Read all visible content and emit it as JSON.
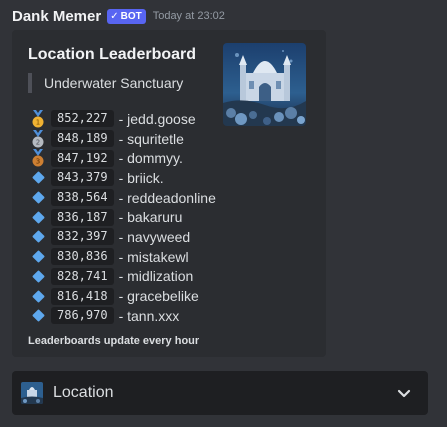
{
  "message": {
    "author": "Dank Memer",
    "bot_badge": "BOT",
    "timestamp": "Today at 23:02"
  },
  "embed": {
    "title": "Location Leaderboard",
    "subtitle": "Underwater Sanctuary",
    "thumbnail_icon": "underwater-sanctuary-image",
    "footer": "Leaderboards update every hour",
    "rows": [
      {
        "icon": "gold-medal-icon",
        "medal_rank": "1",
        "score": "852,227",
        "user": "- jedd.goose"
      },
      {
        "icon": "silver-medal-icon",
        "medal_rank": "2",
        "score": "848,189",
        "user": "- squritetle"
      },
      {
        "icon": "bronze-medal-icon",
        "medal_rank": "3",
        "score": "847,192",
        "user": "- dommyy."
      },
      {
        "icon": "blue-diamond-icon",
        "score": "843,379",
        "user": "- briick."
      },
      {
        "icon": "blue-diamond-icon",
        "score": "838,564",
        "user": "- reddeadonline"
      },
      {
        "icon": "blue-diamond-icon",
        "score": "836,187",
        "user": "- bakaruru"
      },
      {
        "icon": "blue-diamond-icon",
        "score": "832,397",
        "user": "- navyweed"
      },
      {
        "icon": "blue-diamond-icon",
        "score": "830,836",
        "user": "- mistakewl"
      },
      {
        "icon": "blue-diamond-icon",
        "score": "828,741",
        "user": "- midlization"
      },
      {
        "icon": "blue-diamond-icon",
        "score": "816,418",
        "user": "- gracebelike"
      },
      {
        "icon": "blue-diamond-icon",
        "score": "786,970",
        "user": "- tann.xxx"
      }
    ]
  },
  "select_menu": {
    "label": "Location",
    "icon": "chevron-down-icon"
  },
  "colors": {
    "background": "#313338",
    "embed_bg": "#2b2d31",
    "select_bg": "#1e1f22",
    "bot_badge": "#5865f2",
    "diamond": "#5ea8ee",
    "gold": "#f0b232",
    "silver": "#b5bac1",
    "bronze": "#cd7f32"
  }
}
